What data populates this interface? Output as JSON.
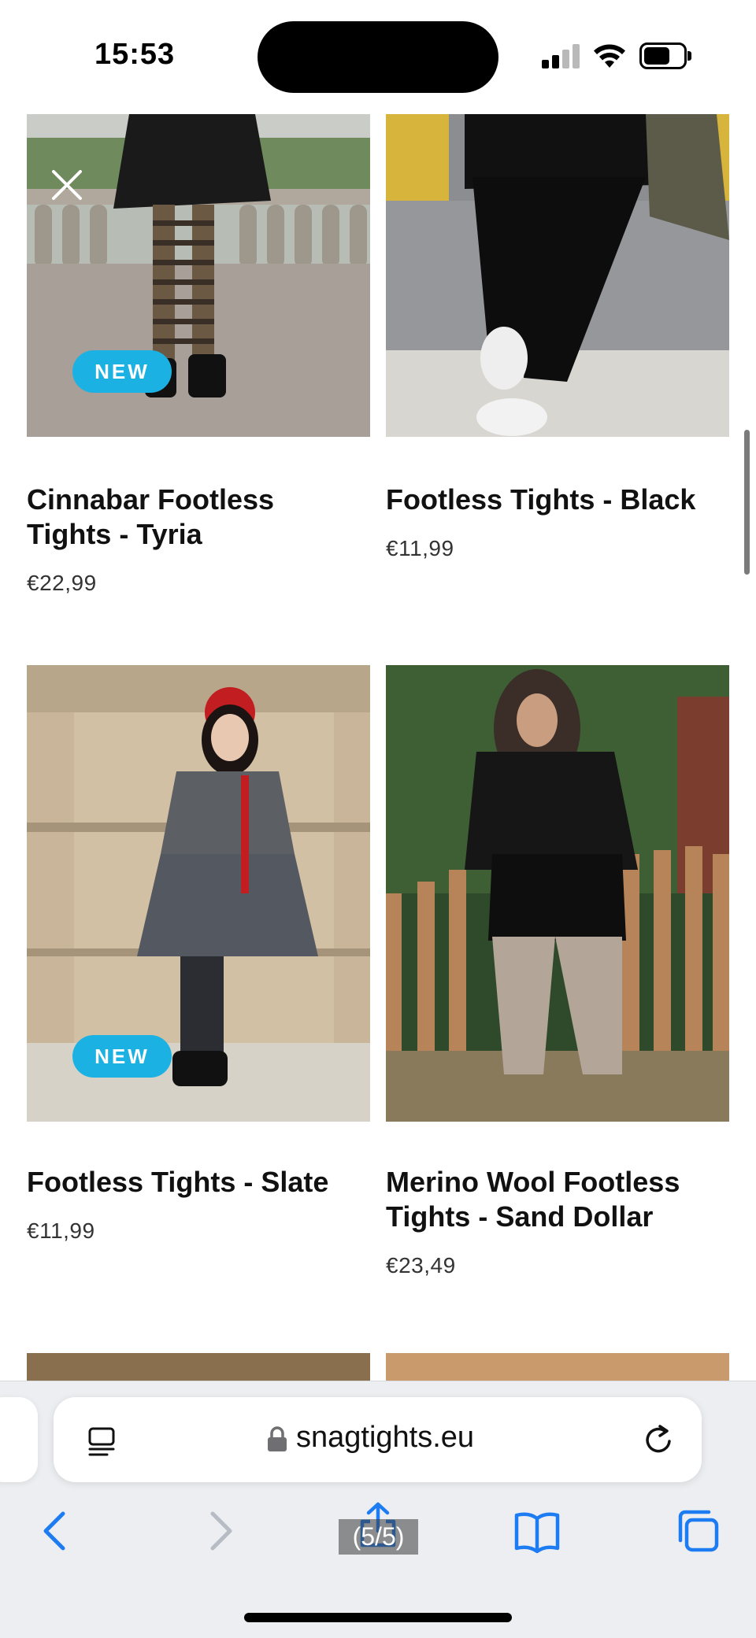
{
  "status_bar": {
    "time": "15:53"
  },
  "products": [
    {
      "title": "Cinnabar Footless Tights - Tyria",
      "price": "€22,99",
      "badge": "NEW"
    },
    {
      "title": "Footless Tights - Black",
      "price": "€11,99",
      "badge": ""
    },
    {
      "title": "Footless Tights - Slate",
      "price": "€11,99",
      "badge": "NEW"
    },
    {
      "title": "Merino Wool Footless Tights - Sand Dollar",
      "price": "€23,49",
      "badge": ""
    }
  ],
  "browser": {
    "url": "snagtights.eu",
    "page_indicator": "(5/5)"
  },
  "icons": {
    "close": "close-icon",
    "reader": "reader-view-icon",
    "lock": "lock-icon",
    "reload": "reload-icon",
    "back": "chevron-left-icon",
    "forward": "chevron-right-icon",
    "share": "share-icon",
    "bookmarks": "book-icon",
    "tabs": "tabs-icon"
  },
  "colors": {
    "badge": "#1bb2e3",
    "accent": "#1e7cf2",
    "disabled": "#b7bcc4"
  }
}
